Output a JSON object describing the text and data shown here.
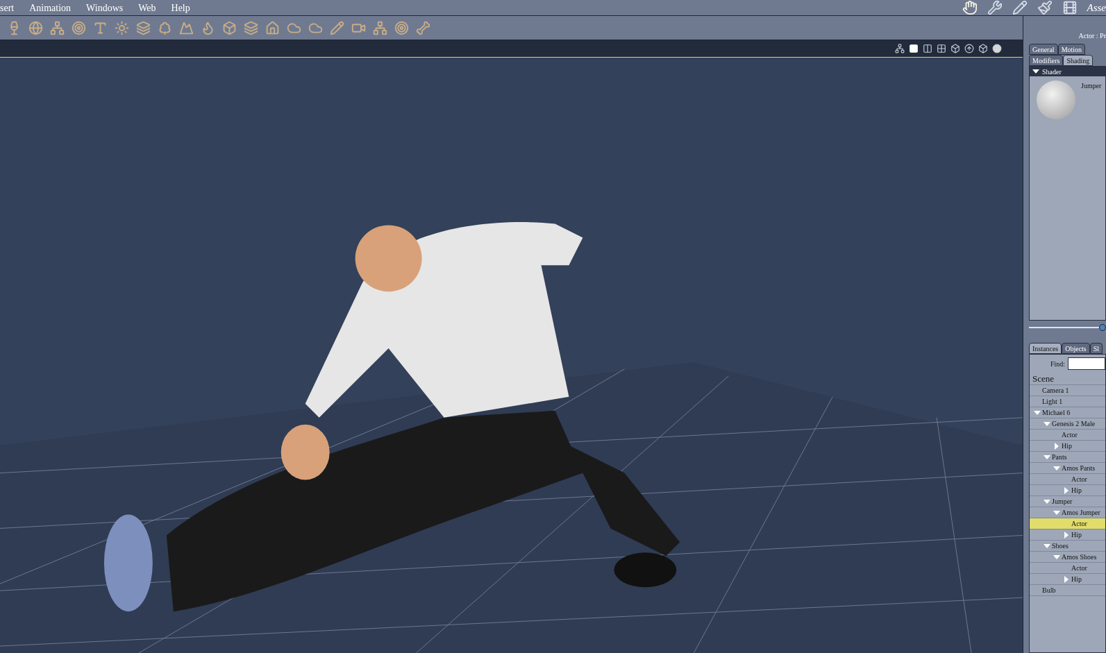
{
  "menu": [
    "sert",
    "Animation",
    "Windows",
    "Web",
    "Help"
  ],
  "room_label": "Asse",
  "actor_label": "Actor : Pr",
  "param_tabs": [
    {
      "label": "General",
      "selected": false
    },
    {
      "label": "Motion",
      "selected": false
    }
  ],
  "param_tabs_2": [
    {
      "label": "Modifiers",
      "selected": false
    },
    {
      "label": "Shading",
      "selected": true
    }
  ],
  "shader": {
    "header": "Shader",
    "expanded": true,
    "material": "Jumper"
  },
  "scene_tabs": [
    {
      "label": "Instances",
      "selected": true
    },
    {
      "label": "Objects",
      "selected": false
    },
    {
      "label": "Sl",
      "selected": false
    }
  ],
  "find_label": "Find:",
  "tree": {
    "title": "Scene",
    "items": [
      {
        "label": "Camera 1",
        "selected": false
      },
      {
        "label": "Light 1",
        "selected": false
      },
      {
        "label": "Michael 6",
        "selected": false,
        "expanded": true,
        "children": [
          {
            "label": "Genesis 2 Male",
            "selected": false,
            "expanded": true,
            "children": [
              {
                "label": "Actor",
                "selected": false
              },
              {
                "label": "Hip",
                "selected": false,
                "expanded": false
              }
            ]
          },
          {
            "label": "Pants",
            "selected": false,
            "expanded": true,
            "children": [
              {
                "label": "Amos Pants",
                "selected": false,
                "expanded": true,
                "children": [
                  {
                    "label": "Actor",
                    "selected": false
                  },
                  {
                    "label": "Hip",
                    "selected": false,
                    "expanded": false
                  }
                ]
              }
            ]
          },
          {
            "label": "Jumper",
            "selected": false,
            "expanded": true,
            "children": [
              {
                "label": "Amos Jumper",
                "selected": false,
                "expanded": true,
                "children": [
                  {
                    "label": "Actor",
                    "selected": true
                  },
                  {
                    "label": "Hip",
                    "selected": false,
                    "expanded": false
                  }
                ]
              }
            ]
          },
          {
            "label": "Shoes",
            "selected": false,
            "expanded": true,
            "children": [
              {
                "label": "Amos Shoes",
                "selected": false,
                "expanded": true,
                "children": [
                  {
                    "label": "Actor",
                    "selected": false
                  },
                  {
                    "label": "Hip",
                    "selected": false,
                    "expanded": false
                  }
                ]
              }
            ]
          }
        ]
      },
      {
        "label": "Bulb",
        "selected": false
      }
    ]
  }
}
